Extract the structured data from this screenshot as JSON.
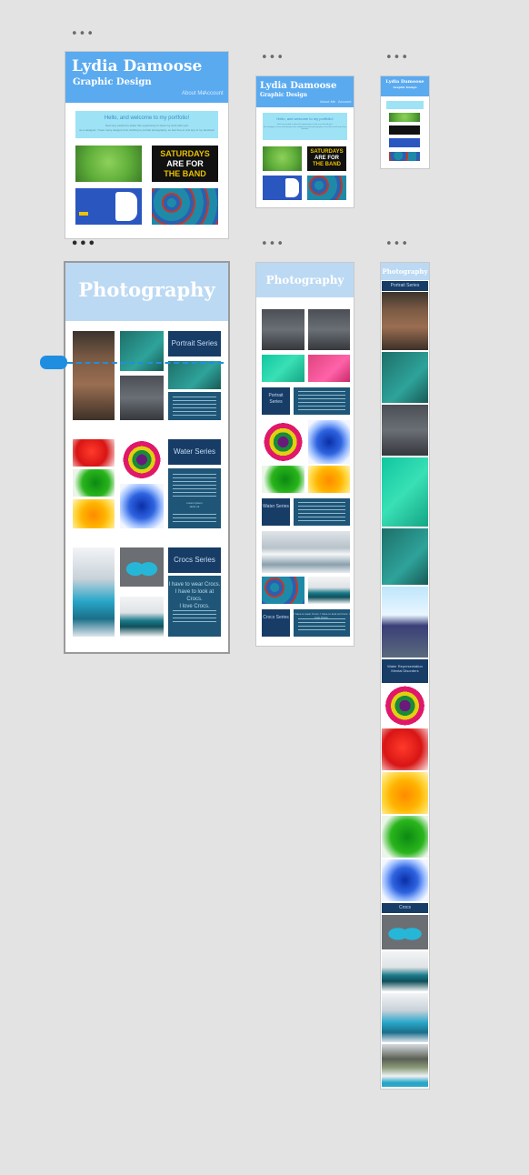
{
  "canvas": {
    "background": "#e3e3e3",
    "accent": "#1f8ee0"
  },
  "home": {
    "name": "Lydia Damoose",
    "subtitle": "Graphic Design",
    "nav": [
      "About Me",
      "Account"
    ],
    "welcome_title": "Hello, and welcome to my portfolio!",
    "welcome_body": [
      "Feel very excited to share this opportunity to show my work with you!",
      "As a designer, I have many designs from clothing to portrait photography, so feel free to visit any of my favorites!"
    ],
    "tiles": [
      "green-eye-photo",
      "saturdays-are-for-the-band",
      "blue-b-logo",
      "character-print-fabric"
    ],
    "saturdays_text": [
      "SATURDAYS",
      "ARE FOR",
      "THE BAND"
    ]
  },
  "photography": {
    "title": "Photography",
    "sections": [
      {
        "label": "Portrait Series",
        "label_tablet": "Portrait Series",
        "label_mobile": "Portrait Series"
      },
      {
        "label": "Water Series",
        "label_tablet": "Water Series",
        "label_mobile": "Water Representation Mental Disorders"
      },
      {
        "label": "Crocs Series",
        "label_tablet": "Crocs Series",
        "label_mobile": "Crocs"
      }
    ],
    "crocs_quote": [
      "I have to wear Crocs.",
      "I have to look at Crocs.",
      "I love Crocs."
    ],
    "crocs_quote_tablet": "I have to wear Crocs. I have to look at Crocs. I love Crocs.",
    "water_caption": [
      "Lorem ipsum",
      "dolor sit"
    ]
  }
}
